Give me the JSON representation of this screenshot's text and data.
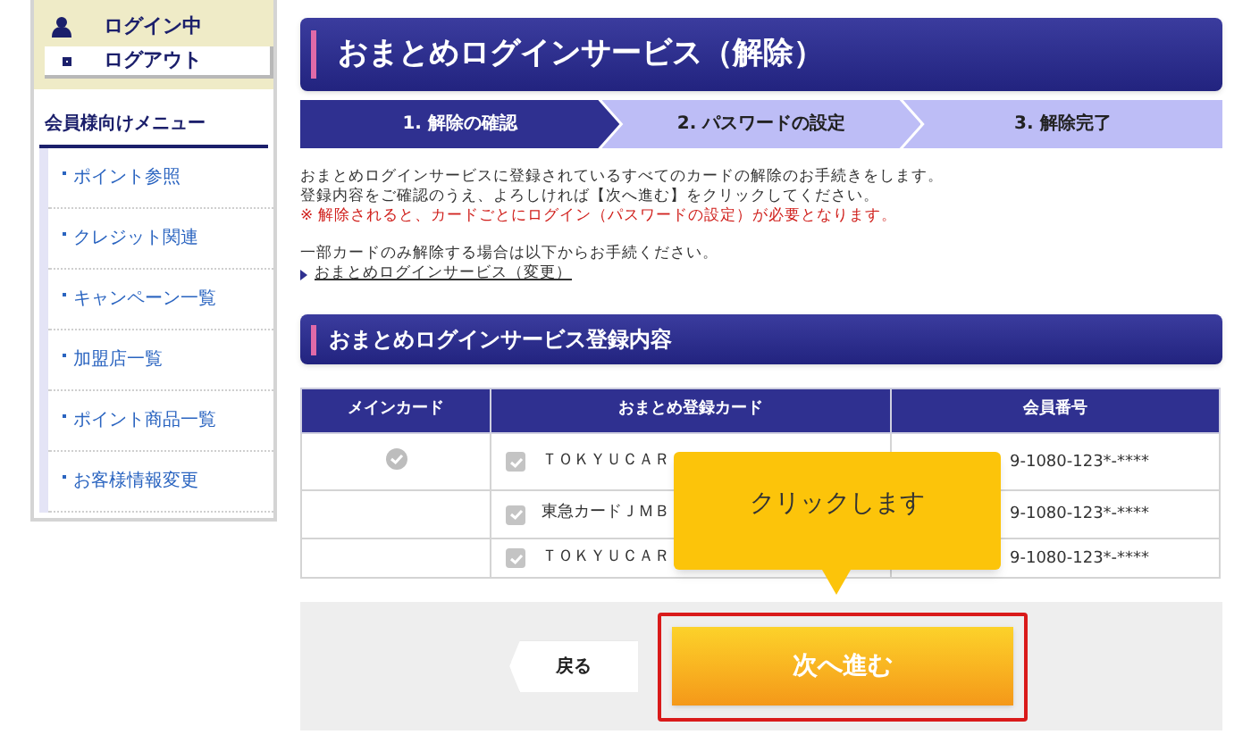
{
  "sidebar": {
    "login_status": "ログイン中",
    "logout_button": "ログアウト",
    "menu_title": "会員様向けメニュー",
    "items": [
      {
        "label": "ポイント参照"
      },
      {
        "label": "クレジット関連"
      },
      {
        "label": "キャンペーン一覧"
      },
      {
        "label": "加盟店一覧"
      },
      {
        "label": "ポイント商品一覧"
      },
      {
        "label": "お客様情報変更"
      }
    ]
  },
  "page_title": "おまとめログインサービス（解除）",
  "steps": [
    {
      "label": "1. 解除の確認",
      "selected": true
    },
    {
      "label": "2. パスワードの設定",
      "selected": false
    },
    {
      "label": "3. 解除完了",
      "selected": false
    }
  ],
  "intro": [
    "おまとめログインサービスに登録されているすべてのカードの解除のお手続きをします。",
    "登録内容をご確認のうえ、よろしければ【次へ進む】をクリックしてください。"
  ],
  "warning": "※ 解除されると、カードごとにログイン（パスワードの設定）が必要となります。",
  "partial_note": "一部カードのみ解除する場合は以下からお手続ください。",
  "change_link": "おまとめログインサービス（変更）",
  "section_title": "おまとめログインサービス登録内容",
  "table": {
    "columns": [
      "メインカード",
      "おまとめ登録カード",
      "会員番号"
    ],
    "rows": [
      {
        "main": true,
        "checked": true,
        "card": "ＴＯＫＹＵＣＡＲ",
        "member_no": "9-1080-123*-****"
      },
      {
        "main": false,
        "checked": true,
        "card": "東急カードＪＭＢ",
        "member_no": "9-1080-123*-****"
      },
      {
        "main": false,
        "checked": true,
        "card": "ＴＯＫＹＵＣＡＲ",
        "member_no": "9-1080-123*-****"
      }
    ]
  },
  "tooltip": "クリックします",
  "back_button": "戻る",
  "next_button": "次へ進む"
}
